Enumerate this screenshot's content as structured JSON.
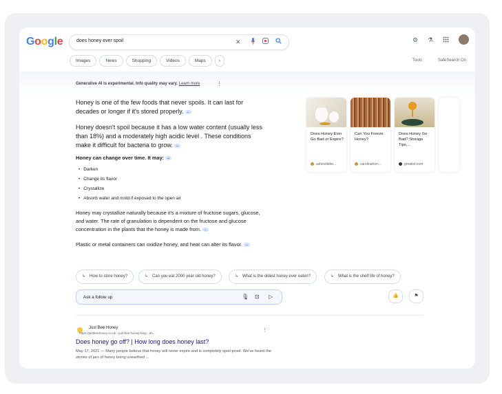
{
  "header": {
    "logo_letters": [
      "G",
      "o",
      "o",
      "g",
      "l",
      "e"
    ],
    "logo_colors": [
      "#4285F4",
      "#EA4335",
      "#FBBC05",
      "#4285F4",
      "#34A853",
      "#EA4335"
    ],
    "search_query": "does honey ever spoil",
    "chips": [
      "Images",
      "News",
      "Shopping",
      "Videos",
      "Maps"
    ],
    "tools_label": "Tools",
    "safesearch_label": "SafeSearch On"
  },
  "ai_overview": {
    "notice": "Generative AI is experimental. Info quality may vary.",
    "learn_more": "Learn more",
    "para1": "Honey is one of the few foods that never spoils. It can last for decades or longer if it's stored properly.",
    "para2": "Honey doesn't spoil because it has a low water content (usually less than 18%) and a moderately high acidic level . These conditions make it difficult for bacteria to grow.",
    "change_heading": "Honey can change over time. It may:",
    "bullets": [
      "Darken",
      "Change its flavor",
      "Crystallize",
      "Absorb water and mold if exposed to the open air"
    ],
    "para3": "Honey may crystallize naturally because it's a mixture of fructose sugars, glucose, and water. The rate of granulation is dependent on the fructose and glucose concentration in the plants that the honey is made from.",
    "para4": "Plastic or metal containers can oxidize honey, and heat can alter its flavor.",
    "image_cards": [
      {
        "title": "Does Honey Ever Go Bad or Expire?",
        "source": "ashevillebe..."
      },
      {
        "title": "Can You Freeze Honey?",
        "source": "carolinahon..."
      },
      {
        "title": "Does Honey Go Bad? Storage Tips,...",
        "source": "greatist.com"
      }
    ],
    "follow_ups": [
      "How to store honey?",
      "Can you eat 2000 year old honey?",
      "What is the oldest honey ever eaten?",
      "What is the shelf life of honey?"
    ],
    "ask_placeholder": "Ask a follow up"
  },
  "result": {
    "site_name": "Just Bee Honey",
    "url": "https://justbeehoney.co.uk › just-bee-honey-blog › do...",
    "title": "Does honey go off? | How long does honey last?",
    "snippet": "May 17, 2021 — Many people believe that honey will never expire and is completely spoil-proof. We've heard the stories of jars of honey being unearthed ..."
  }
}
